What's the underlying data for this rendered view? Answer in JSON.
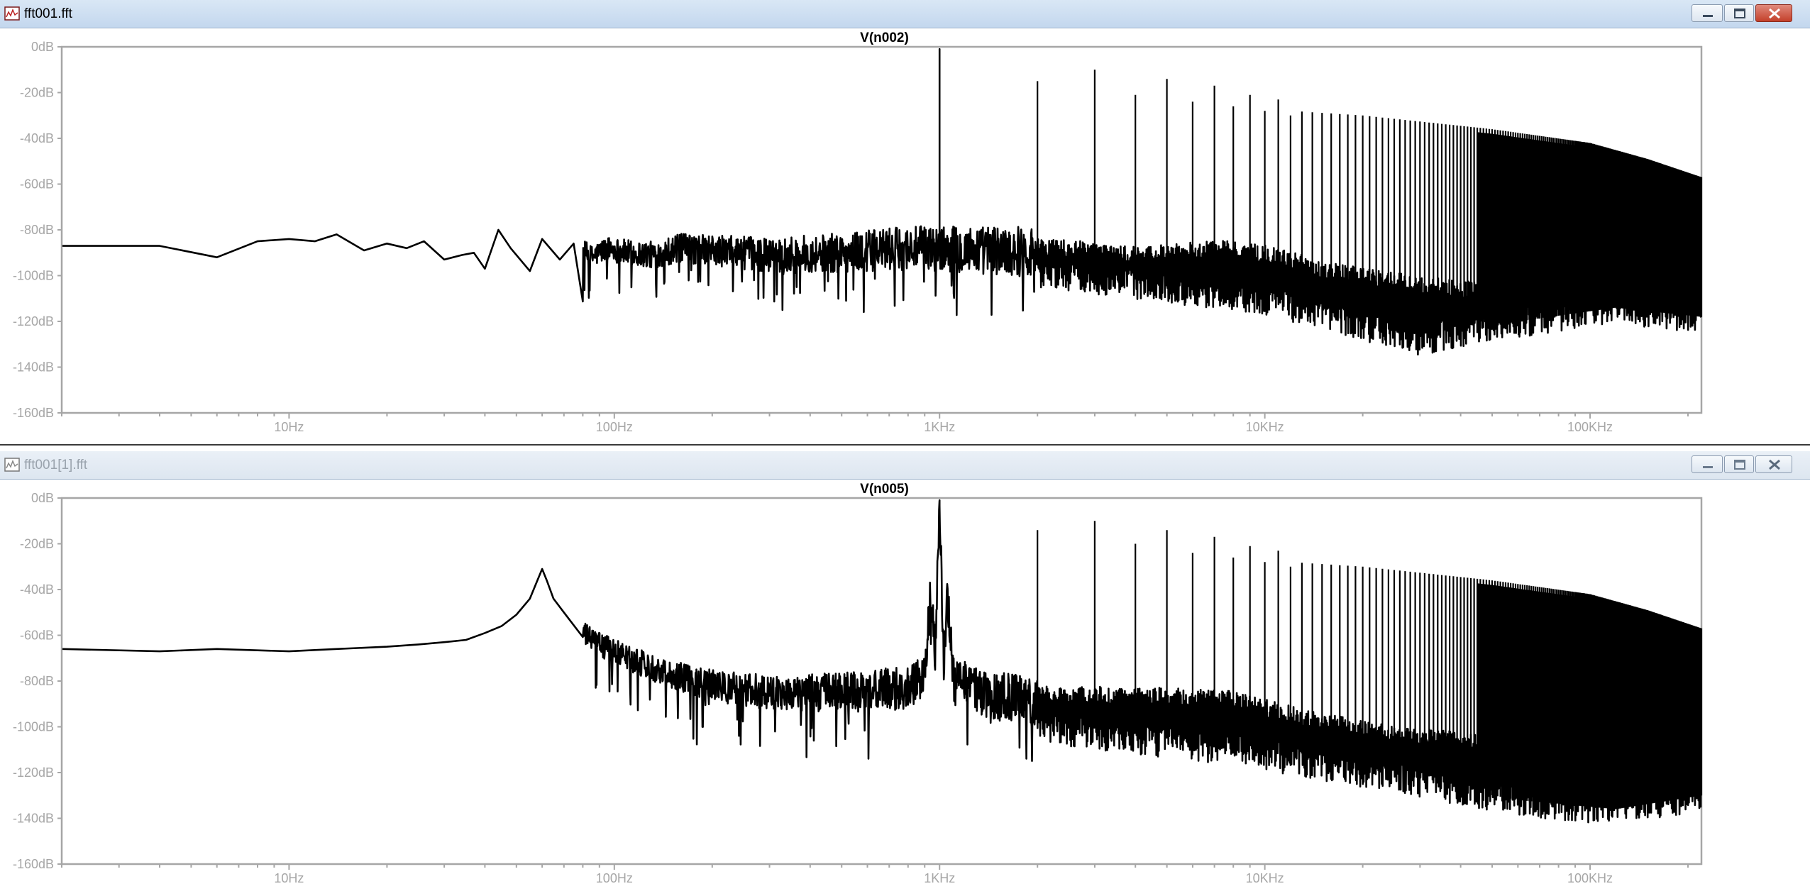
{
  "windows": [
    {
      "title": "fft001.fft",
      "active": true,
      "plot_title": "V(n002)"
    },
    {
      "title": "fft001[1].fft",
      "active": false,
      "plot_title": "V(n005)"
    }
  ],
  "colors": {
    "trace": "#000000",
    "axis_text": "#a6a6a6",
    "frame": "#a6a6a6",
    "titlebar_active": "#c8daf0",
    "close_button": "#c4402b"
  },
  "icons": [
    "waveform-app-icon",
    "minimize-icon",
    "maximize-icon",
    "close-icon"
  ],
  "chart_data": [
    {
      "type": "line",
      "title": "V(n002)",
      "xscale": "log",
      "xlim": [
        2,
        220000
      ],
      "ylim": [
        -160,
        0
      ],
      "y_ticks": [
        "0dB",
        "-20dB",
        "-40dB",
        "-60dB",
        "-80dB",
        "-100dB",
        "-120dB",
        "-140dB",
        "-160dB"
      ],
      "x_ticks": [
        "10Hz",
        "100Hz",
        "1KHz",
        "10KHz",
        "100KHz"
      ],
      "grid": false,
      "series": [
        {
          "fundamental_hz": 1000,
          "fundamental_db": -1,
          "noise_points": [
            [
              2,
              -87
            ],
            [
              4,
              -87
            ],
            [
              6,
              -92
            ],
            [
              8,
              -85
            ],
            [
              10,
              -84
            ],
            [
              12,
              -85
            ],
            [
              14,
              -82
            ],
            [
              17,
              -89
            ],
            [
              20,
              -86
            ],
            [
              23,
              -88
            ],
            [
              26,
              -85
            ],
            [
              30,
              -93
            ],
            [
              34,
              -91
            ],
            [
              37,
              -90
            ],
            [
              40,
              -97
            ],
            [
              44,
              -80
            ],
            [
              48,
              -88
            ],
            [
              55,
              -98
            ],
            [
              60,
              -84
            ],
            [
              68,
              -93
            ],
            [
              75,
              -86
            ],
            [
              85,
              -92
            ],
            [
              95,
              -88
            ],
            [
              110,
              -90
            ],
            [
              130,
              -91
            ],
            [
              160,
              -88
            ],
            [
              200,
              -89
            ],
            [
              300,
              -91
            ],
            [
              500,
              -90
            ],
            [
              800,
              -88
            ],
            [
              1500,
              -89
            ],
            [
              2500,
              -90
            ],
            [
              4000,
              -93
            ],
            [
              7000,
              -90
            ],
            [
              10000,
              -92
            ],
            [
              15000,
              -99
            ],
            [
              25000,
              -104
            ],
            [
              40000,
              -108
            ],
            [
              60000,
              -107
            ],
            [
              100000,
              -106
            ],
            [
              150000,
              -106
            ],
            [
              220000,
              -106
            ]
          ],
          "harmonic_peaks_db": [
            [
              2000,
              -15
            ],
            [
              3000,
              -10
            ],
            [
              4000,
              -21
            ],
            [
              5000,
              -14
            ],
            [
              6000,
              -24
            ],
            [
              7000,
              -17
            ],
            [
              8000,
              -26
            ],
            [
              9000,
              -21
            ],
            [
              10000,
              -28
            ],
            [
              11000,
              -23
            ],
            [
              12000,
              -30
            ]
          ],
          "harmonic_envelope_db": [
            [
              12000,
              -28
            ],
            [
              20000,
              -30
            ],
            [
              50000,
              -36
            ],
            [
              100000,
              -42
            ],
            [
              150000,
              -49
            ],
            [
              220000,
              -57
            ]
          ],
          "low_envelope_db": [
            [
              2000,
              -98
            ],
            [
              10000,
              -110
            ],
            [
              30000,
              -128
            ],
            [
              60000,
              -120
            ],
            [
              120000,
              -114
            ],
            [
              220000,
              -118
            ]
          ]
        }
      ]
    },
    {
      "type": "line",
      "title": "V(n005)",
      "xscale": "log",
      "xlim": [
        2,
        220000
      ],
      "ylim": [
        -160,
        0
      ],
      "y_ticks": [
        "0dB",
        "-20dB",
        "-40dB",
        "-60dB",
        "-80dB",
        "-100dB",
        "-120dB",
        "-140dB",
        "-160dB"
      ],
      "x_ticks": [
        "10Hz",
        "100Hz",
        "1KHz",
        "10KHz",
        "100KHz"
      ],
      "grid": false,
      "series": [
        {
          "fundamental_hz": 1000,
          "fundamental_db": -1,
          "noise_points": [
            [
              2,
              -66
            ],
            [
              4,
              -67
            ],
            [
              6,
              -66
            ],
            [
              10,
              -67
            ],
            [
              14,
              -66
            ],
            [
              20,
              -65
            ],
            [
              25,
              -64
            ],
            [
              30,
              -63
            ],
            [
              35,
              -62
            ],
            [
              40,
              -59
            ],
            [
              45,
              -56
            ],
            [
              50,
              -51
            ],
            [
              55,
              -44
            ],
            [
              58,
              -36
            ],
            [
              60,
              -31
            ],
            [
              62,
              -36
            ],
            [
              65,
              -44
            ],
            [
              70,
              -50
            ],
            [
              80,
              -59
            ],
            [
              90,
              -64
            ],
            [
              100,
              -67
            ],
            [
              120,
              -72
            ],
            [
              150,
              -77
            ],
            [
              200,
              -82
            ],
            [
              300,
              -85
            ],
            [
              500,
              -85
            ],
            [
              800,
              -83
            ],
            [
              900,
              -78
            ],
            [
              940,
              -42
            ],
            [
              970,
              -70
            ],
            [
              1000,
              -1
            ],
            [
              1030,
              -70
            ],
            [
              1060,
              -42
            ],
            [
              1100,
              -80
            ],
            [
              1500,
              -87
            ],
            [
              2000,
              -88
            ],
            [
              4000,
              -88
            ],
            [
              8000,
              -90
            ],
            [
              15000,
              -100
            ],
            [
              30000,
              -106
            ],
            [
              60000,
              -110
            ],
            [
              100000,
              -112
            ],
            [
              150000,
              -114
            ],
            [
              220000,
              -116
            ]
          ],
          "harmonic_peaks_db": [
            [
              2000,
              -14
            ],
            [
              3000,
              -10
            ],
            [
              4000,
              -20
            ],
            [
              5000,
              -14
            ],
            [
              6000,
              -24
            ],
            [
              7000,
              -17
            ],
            [
              8000,
              -26
            ],
            [
              9000,
              -21
            ],
            [
              10000,
              -28
            ],
            [
              11000,
              -23
            ],
            [
              12000,
              -30
            ]
          ],
          "harmonic_envelope_db": [
            [
              12000,
              -28
            ],
            [
              20000,
              -30
            ],
            [
              50000,
              -36
            ],
            [
              100000,
              -42
            ],
            [
              150000,
              -49
            ],
            [
              220000,
              -57
            ]
          ],
          "low_envelope_db": [
            [
              2000,
              -100
            ],
            [
              10000,
              -112
            ],
            [
              30000,
              -124
            ],
            [
              60000,
              -132
            ],
            [
              120000,
              -136
            ],
            [
              220000,
              -130
            ]
          ]
        }
      ]
    }
  ]
}
